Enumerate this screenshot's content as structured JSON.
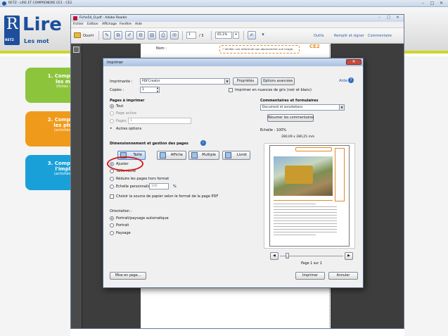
{
  "outer_window": {
    "title": "RETZ - LIRE ET COMPRENDRE CE1 - CE2",
    "controls": [
      "–",
      "□",
      "✕"
    ]
  },
  "retz_app": {
    "logo_letter": "R",
    "logo_text": "RETZ",
    "title": "Lire",
    "subtitle": "Les mot",
    "cards": [
      {
        "line1": "1. Comp",
        "line2": "les m",
        "line3": "(fiches :",
        "color": "#8cc43c"
      },
      {
        "line1": "2. Comp",
        "line2": "les ph",
        "line3": "(activités",
        "color": "#f09a1c"
      },
      {
        "line1": "3. Comp",
        "line2": "l'impl",
        "line3": "(activités",
        "color": "#1aa0d8"
      }
    ]
  },
  "reader": {
    "title": "Fiche54_O.pdf - Adobe Reader",
    "controls": [
      "–",
      "□",
      "✕"
    ],
    "menu": [
      "Fichier",
      "Edition",
      "Affichage",
      "Fenêtre",
      "Aide"
    ],
    "toolbar": {
      "open_label": "Ouvrir",
      "page_current": "1",
      "page_total": "/ 3",
      "zoom": "65,1%",
      "tools_label": "Outils",
      "fill_sign_label": "Remplir et signer",
      "comment_label": "Commentaire"
    },
    "document": {
      "name_label": "Nom :",
      "warning_text": "• Verifier une reformule non abonnement une image.",
      "level_tag": "CE2"
    }
  },
  "print_dialog": {
    "title": "Imprimer",
    "close_label": "✕",
    "printer_label": "Imprimante :",
    "printer_value": "PDFCreator",
    "properties_button": "Propriétés",
    "advanced_button": "Options avancées",
    "help_link": "Aide",
    "copies_label": "Copies :",
    "copies_value": "1",
    "grayscale_label": "Imprimer en nuances de gris (noir et blanc)",
    "pages_section": "Pages à imprimer",
    "pages_options": [
      {
        "label": "Tout",
        "selected": true,
        "enabled": true
      },
      {
        "label": "Page active",
        "selected": false,
        "enabled": false
      },
      {
        "label": "Pages",
        "selected": false,
        "enabled": false
      }
    ],
    "pages_range_value": "1",
    "more_options": "Autres options",
    "sizing_section": "Dimensionnement et gestion des pages",
    "sizing_tabs": [
      "Taille",
      "Affiche",
      "Multiple",
      "Livret"
    ],
    "size_options": [
      {
        "label": "Ajuster",
        "selected": true
      },
      {
        "label": "Taille réelle",
        "selected": false
      },
      {
        "label": "Réduire les pages hors format",
        "selected": false
      },
      {
        "label": "Echelle personnalisée :",
        "selected": false
      }
    ],
    "custom_scale_value": "100",
    "custom_scale_unit": "%",
    "paper_source_label": "Choisir la source de papier selon le format de la page PDF",
    "orientation_section": "Orientation :",
    "orientation_options": [
      {
        "label": "Portrait/paysage automatique",
        "selected": true
      },
      {
        "label": "Portrait",
        "selected": false
      },
      {
        "label": "Paysage",
        "selected": false
      }
    ],
    "comments_section": "Commentaires et formulaires",
    "comments_value": "Document et annotations",
    "summarize_button": "Résumer les commentaires",
    "scale_label": "Echelle : 100%",
    "preview_size": "280,09 x 280,25 mm",
    "page_indicator": "Page 1 sur 1",
    "page_setup_button": "Mise en page...",
    "print_button": "Imprimer",
    "cancel_button": "Annuler"
  }
}
